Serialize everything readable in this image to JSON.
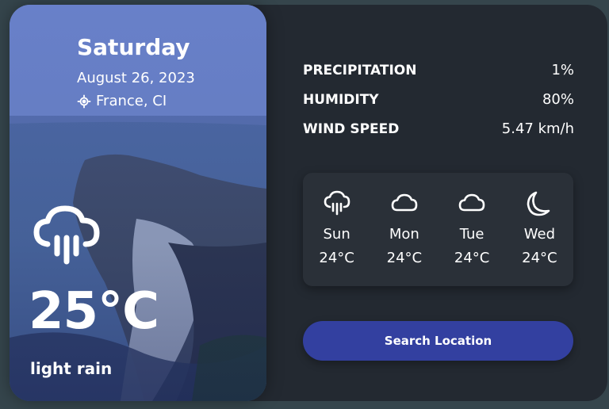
{
  "today": {
    "day": "Saturday",
    "date": "August 26, 2023",
    "location": "France, CI",
    "location_icon": "location-crosshair-icon",
    "weather_icon": "rain-cloud-icon",
    "temperature": "25°C",
    "description": "light rain"
  },
  "stats": [
    {
      "label": "PRECIPITATION",
      "value": "1%"
    },
    {
      "label": "HUMIDITY",
      "value": "80%"
    },
    {
      "label": "WIND SPEED",
      "value": "5.47 km/h"
    }
  ],
  "forecast": [
    {
      "day": "Sun",
      "temp": "24°C",
      "icon": "rain-cloud-icon"
    },
    {
      "day": "Mon",
      "temp": "24°C",
      "icon": "cloud-icon"
    },
    {
      "day": "Tue",
      "temp": "24°C",
      "icon": "cloud-icon"
    },
    {
      "day": "Wed",
      "temp": "24°C",
      "icon": "moon-icon"
    }
  ],
  "search_button": {
    "label": "Search Location"
  },
  "colors": {
    "accent": "#3340a0",
    "panel": "#232931",
    "card": "#2a3038",
    "page": "#35454c"
  }
}
